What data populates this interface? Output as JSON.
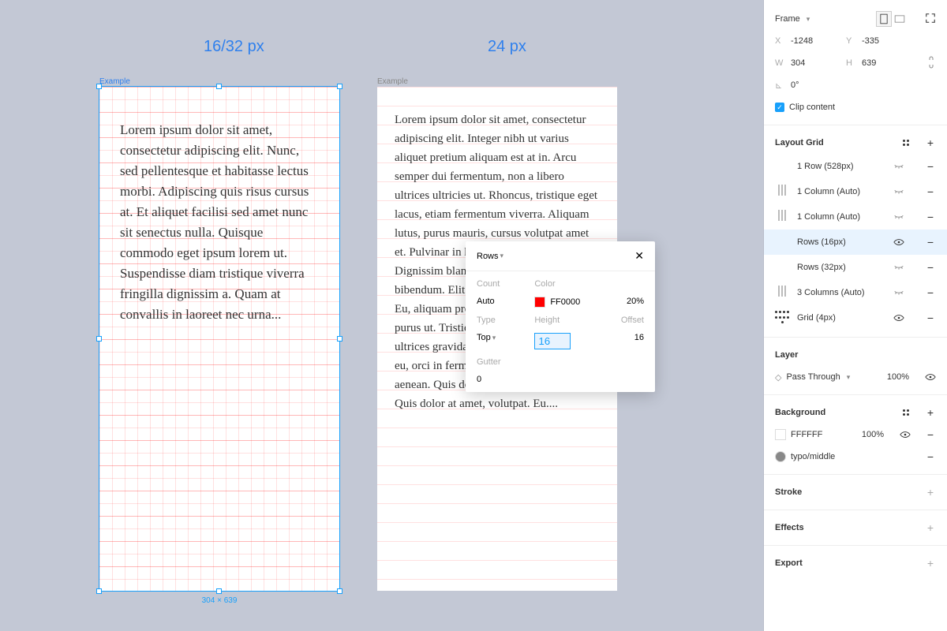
{
  "canvas": {
    "title_left": "16/32 px",
    "title_right": "24 px",
    "frame1": {
      "label": "Example",
      "text": "Lorem ipsum dolor sit amet, consectetur adipiscing elit. Nunc, sed pellentesque et habitasse lectus morbi. Adipiscing quis risus cursus at. Et aliquet facilisi sed amet nunc sit senectus nulla. Quisque commodo eget ipsum lorem ut. Suspendisse diam tristique viverra fringilla dignissim a. Quam at convallis in laoreet nec urna...",
      "dim": "304 × 639"
    },
    "frame2": {
      "label": "Example",
      "text": "Lorem ipsum dolor sit amet, consectetur adipiscing elit. Integer nibh ut varius aliquet pretium aliquam est at in. Arcu semper dui fermentum, non a libero ultrices ultricies ut. Rhoncus, tristique eget lacus, etiam fermentum viverra. Aliquam lutus, purus mauris, cursus volutpat amet et. Pulvinar in hendrerit at aliquet et. Dignissim blandit dignissim viverra bibendum. Elit sed at amet faucibus eu. Eu, aliquam pretium, nunc eget mi, risus, purus ut. Tristique sed nam. Eu, leo turpice ultrices gravida lacinia urna. Ipsum dolor eu, orci in fermentum euismod ultrices aenean. Quis dolor at amet, volutpat. Eu. Quis dolor at amet, volutpat. Eu...."
    }
  },
  "inspector": {
    "frame_label": "Frame",
    "x_label": "X",
    "x_val": "-1248",
    "y_label": "Y",
    "y_val": "-335",
    "w_label": "W",
    "w_val": "304",
    "h_label": "H",
    "h_val": "639",
    "rot_label": "⟂",
    "rot_val": "0°",
    "clip_label": "Clip content",
    "layout_grid_title": "Layout Grid",
    "grids": [
      {
        "icon": "row",
        "label": "1 Row (528px)",
        "vis": "closed"
      },
      {
        "icon": "col",
        "label": "1 Column (Auto)",
        "vis": "closed"
      },
      {
        "icon": "col",
        "label": "1 Column (Auto)",
        "vis": "closed"
      },
      {
        "icon": "row",
        "label": "Rows (16px)",
        "vis": "open",
        "active": true
      },
      {
        "icon": "row",
        "label": "Rows (32px)",
        "vis": "closed"
      },
      {
        "icon": "col",
        "label": "3 Columns (Auto)",
        "vis": "closed"
      },
      {
        "icon": "grid",
        "label": "Grid (4px)",
        "vis": "open"
      }
    ],
    "layer_title": "Layer",
    "layer_mode": "Pass Through",
    "layer_opacity": "100%",
    "bg_title": "Background",
    "bg_color": "FFFFFF",
    "bg_opacity": "100%",
    "typo_label": "typo/middle",
    "stroke_title": "Stroke",
    "effects_title": "Effects",
    "export_title": "Export"
  },
  "popup": {
    "title": "Rows",
    "count_lbl": "Count",
    "count_val": "Auto",
    "color_lbl": "Color",
    "color_val": "FF0000",
    "color_op": "20%",
    "type_lbl": "Type",
    "type_val": "Top",
    "height_lbl": "Height",
    "height_val": "16",
    "offset_lbl": "Offset",
    "offset_val": "16",
    "gutter_lbl": "Gutter",
    "gutter_val": "0"
  },
  "colors": {
    "accent": "#18A0FB"
  }
}
